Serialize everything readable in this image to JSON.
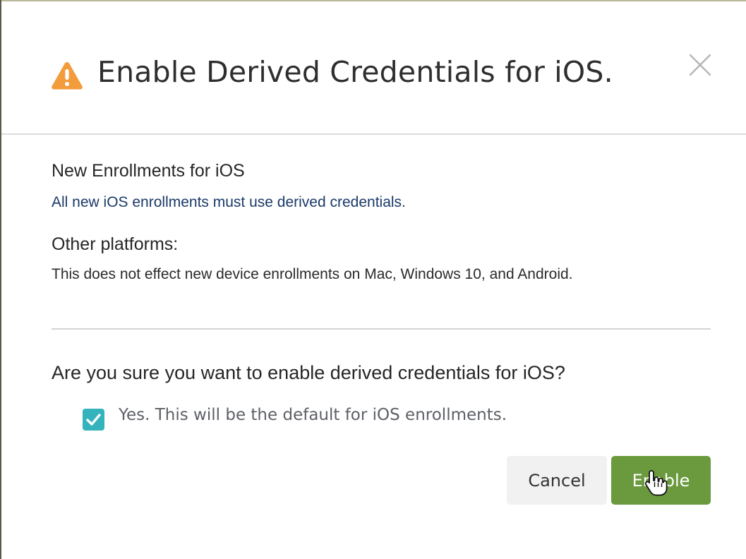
{
  "dialog": {
    "title": "Enable Derived Credentials for iOS.",
    "title_icon": "warning-icon",
    "close_icon": "close-icon"
  },
  "sections": {
    "new_enrollments": {
      "heading": "New Enrollments for iOS",
      "text": "All new iOS enrollments must use derived credentials."
    },
    "other_platforms": {
      "heading": "Other platforms:",
      "text": "This does not effect new device enrollments on Mac, Windows 10, and Android."
    }
  },
  "confirm": {
    "question": "Are you sure you want to enable derived credentials for iOS?",
    "checkbox_label": "Yes. This will be the default for iOS enrollments.",
    "checkbox_checked": true
  },
  "buttons": {
    "cancel": "Cancel",
    "enable": "Enable"
  },
  "colors": {
    "warning": "#f39c3c",
    "checkbox": "#35b3bd",
    "enable_button": "#6a9a3d",
    "cancel_button": "#f1f1f1"
  },
  "cursor_icon": "hand-pointer-icon"
}
